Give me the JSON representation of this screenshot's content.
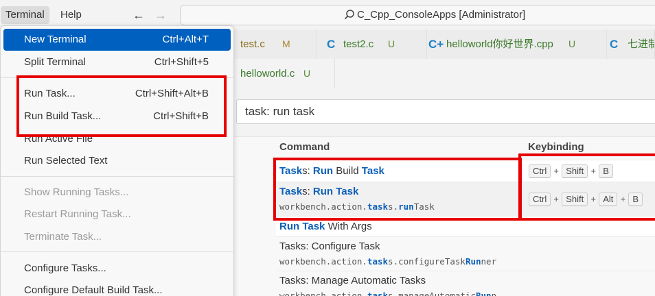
{
  "menubar": {
    "terminal": "Terminal",
    "help": "Help"
  },
  "nav": {
    "back": "←",
    "forward": "→"
  },
  "command_center": {
    "text": "C_Cpp_ConsoleApps [Administrator]",
    "icon": "search-icon"
  },
  "tabs": [
    {
      "icon": "",
      "name": "test.c",
      "status": "M"
    },
    {
      "icon": "C",
      "name": "test2.c",
      "status": "U"
    },
    {
      "icon": "C+",
      "name": "helloworld你好世界.cpp",
      "status": "U"
    },
    {
      "icon": "C",
      "name": "七进制",
      "status": ""
    },
    {
      "icon": "",
      "name": "helloworld.c",
      "status": "U"
    }
  ],
  "quick_pick": {
    "input_value": "task: run task",
    "header_command": "Command",
    "header_keybinding": "Keybinding",
    "rows": [
      {
        "label": "Tasks: Run Build Task",
        "sub": "",
        "keys": [
          "Ctrl",
          "Shift",
          "B"
        ]
      },
      {
        "label": "Tasks: Run Task",
        "sub": "workbench.action.tasks.runTask",
        "keys": [
          "Ctrl",
          "Shift",
          "Alt",
          "B"
        ]
      },
      {
        "label": "Run Task With Args",
        "sub": "",
        "keys": []
      },
      {
        "label": "Tasks: Configure Task",
        "sub": "workbench.action.tasks.configureTaskRunner",
        "keys": []
      },
      {
        "label": "Tasks: Manage Automatic Tasks",
        "sub": "workbench.action.tasks.manageAutomaticRunn",
        "keys": []
      }
    ]
  },
  "terminal_menu": [
    {
      "label": "New Terminal",
      "shortcut": "Ctrl+Alt+T",
      "state": "selected"
    },
    {
      "label": "Split Terminal",
      "shortcut": "Ctrl+Shift+5",
      "state": "normal"
    },
    {
      "label": "Run Task...",
      "shortcut": "Ctrl+Shift+Alt+B",
      "state": "normal"
    },
    {
      "label": "Run Build Task...",
      "shortcut": "Ctrl+Shift+B",
      "state": "normal"
    },
    {
      "label": "Run Active File",
      "shortcut": "",
      "state": "normal"
    },
    {
      "label": "Run Selected Text",
      "shortcut": "",
      "state": "normal"
    },
    {
      "label": "Show Running Tasks...",
      "shortcut": "",
      "state": "disabled"
    },
    {
      "label": "Restart Running Task...",
      "shortcut": "",
      "state": "disabled"
    },
    {
      "label": "Terminate Task...",
      "shortcut": "",
      "state": "disabled"
    },
    {
      "label": "Configure Tasks...",
      "shortcut": "",
      "state": "normal"
    },
    {
      "label": "Configure Default Build Task...",
      "shortcut": "",
      "state": "normal"
    }
  ],
  "colors": {
    "accent": "#0060c0",
    "annotation": "#e60000",
    "highlight": "#0b5fb8"
  }
}
